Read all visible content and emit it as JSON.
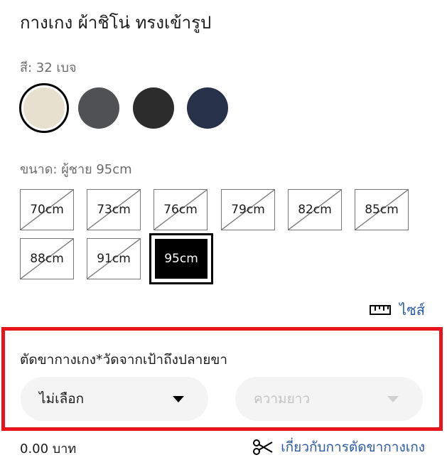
{
  "product": {
    "title": "กางเกง ผ้าชิโน่ ทรงเข้ารูป"
  },
  "color": {
    "label": "สี: 32 เบจ",
    "swatches": [
      {
        "name": "beige",
        "hex": "#e8e0cf",
        "selected": true
      },
      {
        "name": "gray",
        "hex": "#4f5153",
        "selected": false
      },
      {
        "name": "black",
        "hex": "#2c2c2c",
        "selected": false
      },
      {
        "name": "navy",
        "hex": "#27324a",
        "selected": false
      }
    ]
  },
  "size": {
    "label": "ขนาด: ผู้ชาย 95cm",
    "options": [
      {
        "label": "70cm",
        "available": false
      },
      {
        "label": "73cm",
        "available": false
      },
      {
        "label": "76cm",
        "available": false
      },
      {
        "label": "79cm",
        "available": false
      },
      {
        "label": "82cm",
        "available": false
      },
      {
        "label": "85cm",
        "available": false
      },
      {
        "label": "88cm",
        "available": false
      },
      {
        "label": "91cm",
        "available": false
      },
      {
        "label": "95cm",
        "available": true,
        "selected": true
      }
    ],
    "guide_label": "ไซส์"
  },
  "hem": {
    "label": "ตัดขากางเกง*วัดจากเป้าถึงปลายขา",
    "option_value": "ไม่เลือก",
    "length_placeholder": "ความยาว"
  },
  "price": "0.00 บาท",
  "about_link": "เกี่ยวกับการตัดขากางเกง",
  "colors": {
    "accent_link": "#2a5ba8",
    "highlight": "#e8141b"
  }
}
